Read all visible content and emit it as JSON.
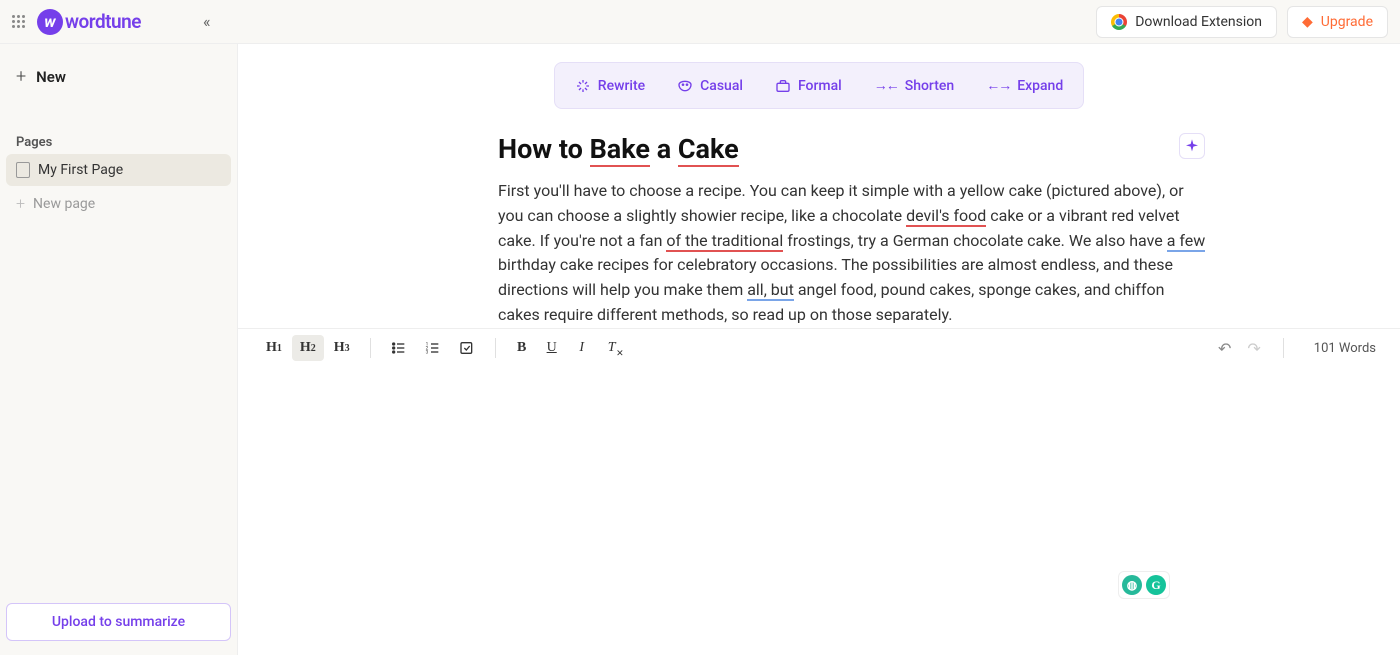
{
  "header": {
    "logo_text": "wordtune",
    "download_btn": "Download Extension",
    "upgrade_btn": "Upgrade"
  },
  "sidebar": {
    "new_btn": "New",
    "pages_label": "Pages",
    "items": [
      {
        "label": "My First Page",
        "active": true
      }
    ],
    "new_page": "New page",
    "upload_btn": "Upload to summarize"
  },
  "actions": {
    "rewrite": "Rewrite",
    "casual": "Casual",
    "formal": "Formal",
    "shorten": "Shorten",
    "expand": "Expand"
  },
  "document": {
    "title_pre": "How to ",
    "title_u1": "Bake",
    "title_mid": " a ",
    "title_u2": "Cake",
    "p1a": "First you'll have to choose a recipe. You can keep it simple with a yellow cake (pictured above), or you can choose a slightly showier recipe, like a chocolate ",
    "p1u1": "devil's food",
    "p1b": " cake or a vibrant red velvet cake. If you're not a fan ",
    "p1u2": "of the traditional",
    "p1c": " frostings, try a German chocolate cake. We also have ",
    "p1u3": "a few",
    "p1d": " birthday cake recipes for celebratory occasions. The possibilities are almost endless, and these directions will help you make them ",
    "p1u4": "all, but",
    "p1e": " angel food, pound cakes, sponge cakes, and chiffon cakes require different methods, so read up on those separately."
  },
  "footer": {
    "word_count": "101 Words"
  }
}
